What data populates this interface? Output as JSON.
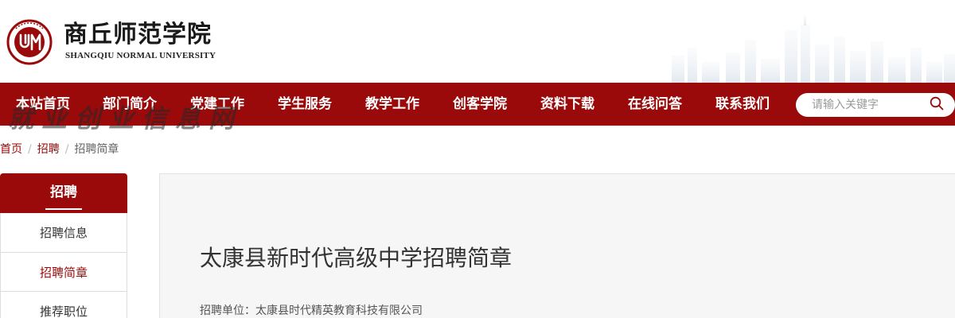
{
  "header": {
    "logo_text_cn": "商丘师范学院",
    "logo_text_en": "SHANGQIU NORMAL UNIVERSITY",
    "seal_letters": "SQNU",
    "colors": {
      "brand": "#9a0a0a",
      "skyline": "#dfe6ee"
    }
  },
  "nav": {
    "items": [
      {
        "label": "本站首页"
      },
      {
        "label": "部门简介"
      },
      {
        "label": "党建工作"
      },
      {
        "label": "学生服务"
      },
      {
        "label": "教学工作"
      },
      {
        "label": "创客学院"
      },
      {
        "label": "资料下载"
      },
      {
        "label": "在线问答"
      },
      {
        "label": "联系我们"
      }
    ],
    "search_placeholder": "请输入关键字",
    "search_icon": "search-icon",
    "watermark": "就业创业信息网"
  },
  "breadcrumb": {
    "home": "首页",
    "section": "招聘",
    "current": "招聘简章"
  },
  "sidebar": {
    "title": "招聘",
    "items": [
      {
        "label": "招聘信息"
      },
      {
        "label": "招聘简章"
      },
      {
        "label": "推荐职位"
      }
    ]
  },
  "article": {
    "title": "太康县新时代高级中学招聘简章",
    "meta": "招聘单位：太康县时代精英教育科技有限公司"
  }
}
